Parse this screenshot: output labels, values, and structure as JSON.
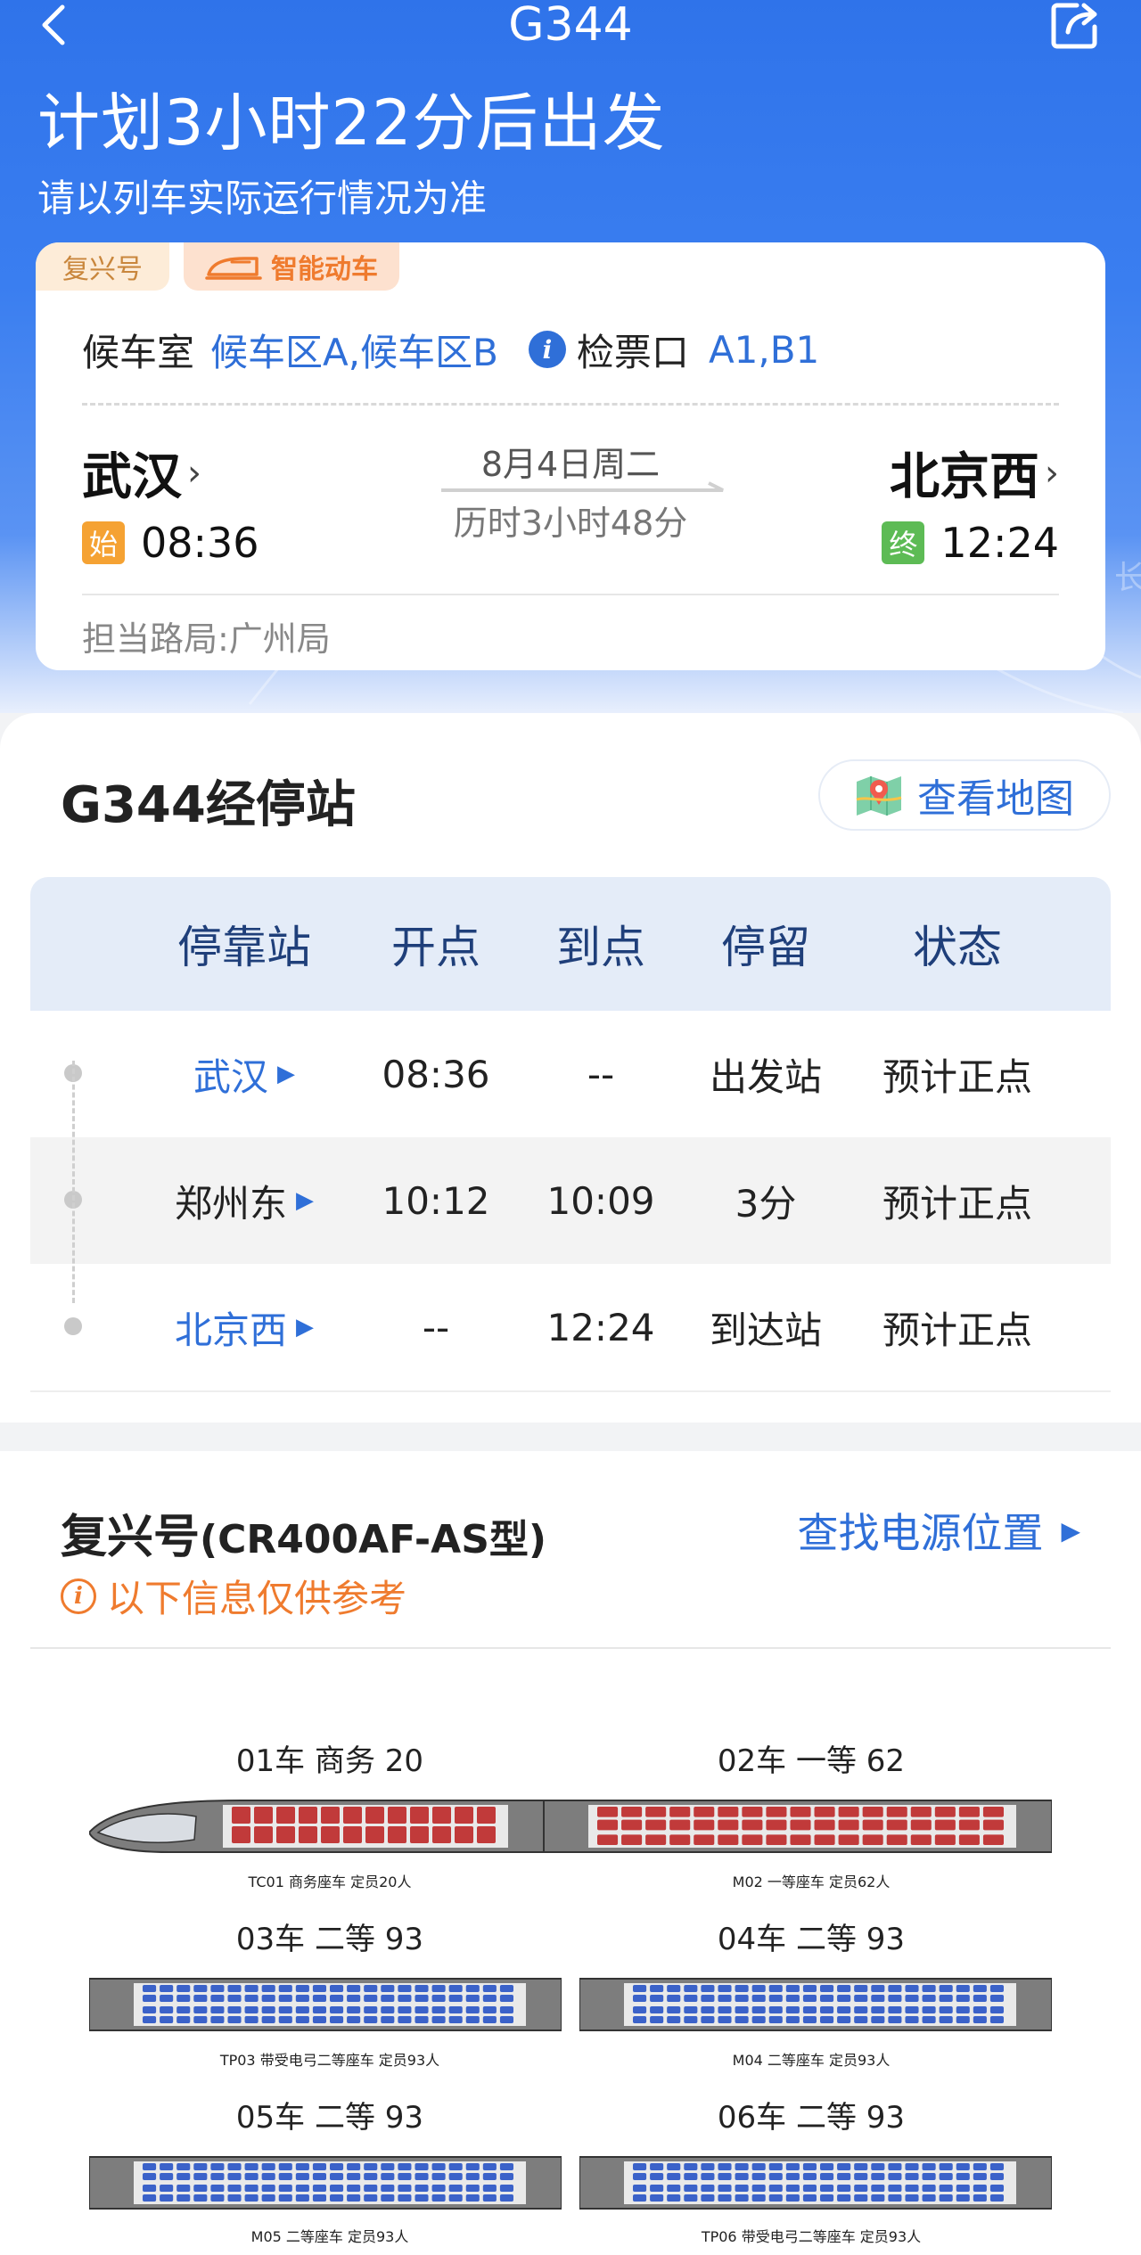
{
  "nav": {
    "title": "G344"
  },
  "hero": {
    "countdown": "计划3小时22分后出发",
    "note": "请以列车实际运行情况为准"
  },
  "trip": {
    "tag_train": "复兴号",
    "tag_smart": "智能动车",
    "waiting_label": "候车室",
    "waiting_value": "候车区A,候车区B",
    "gate_label": "检票口",
    "gate_value": "A1,B1",
    "from": "武汉",
    "to": "北京西",
    "date": "8月4日周二",
    "duration": "历时3小时48分",
    "start_badge": "始",
    "end_badge": "终",
    "depart_time": "08:36",
    "arrive_time": "12:24",
    "bureau": "担当路局:广州局"
  },
  "stops": {
    "title": "G344经停站",
    "map_button": "查看地图",
    "headers": [
      "停靠站",
      "开点",
      "到点",
      "停留",
      "状态"
    ],
    "rows": [
      {
        "station": "武汉",
        "depart": "08:36",
        "arrive": "--",
        "stay": "出发站",
        "status": "预计正点"
      },
      {
        "station": "郑州东",
        "depart": "10:12",
        "arrive": "10:09",
        "stay": "3分",
        "status": "预计正点"
      },
      {
        "station": "北京西",
        "depart": "--",
        "arrive": "12:24",
        "stay": "到达站",
        "status": "预计正点"
      }
    ]
  },
  "train": {
    "model_name": "复兴号",
    "model_code": "(CR400AF-AS型)",
    "power_link": "查找电源位置",
    "ref_note": "以下信息仅供参考",
    "cars": [
      {
        "label": "01车 商务 20",
        "caption": "TC01 商务座车 定员20人",
        "type": "business",
        "color": "#c13a3a"
      },
      {
        "label": "02车 一等 62",
        "caption": "M02 一等座车 定员62人",
        "type": "first",
        "color": "#c13a3a"
      },
      {
        "label": "03车 二等 93",
        "caption": "TP03 带受电弓二等座车 定员93人",
        "type": "second",
        "color": "#3b62c9"
      },
      {
        "label": "04车 二等 93",
        "caption": "M04 二等座车 定员93人",
        "type": "second",
        "color": "#3b62c9"
      },
      {
        "label": "05车 二等 93",
        "caption": "M05 二等座车 定员93人",
        "type": "second",
        "color": "#3b62c9"
      },
      {
        "label": "06车 二等 93",
        "caption": "TP06 带受电弓二等座车 定员93人",
        "type": "second",
        "color": "#3b62c9"
      }
    ]
  },
  "colors": {
    "primary": "#2f73ea",
    "link": "#2f6fd8",
    "orange": "#ef7b2e",
    "business_seat": "#c13a3a",
    "second_seat": "#3b62c9"
  },
  "icons": [
    "back-icon",
    "share-icon",
    "train-icon",
    "info-icon",
    "map-icon",
    "chevron-right-icon",
    "triangle-right-icon"
  ]
}
